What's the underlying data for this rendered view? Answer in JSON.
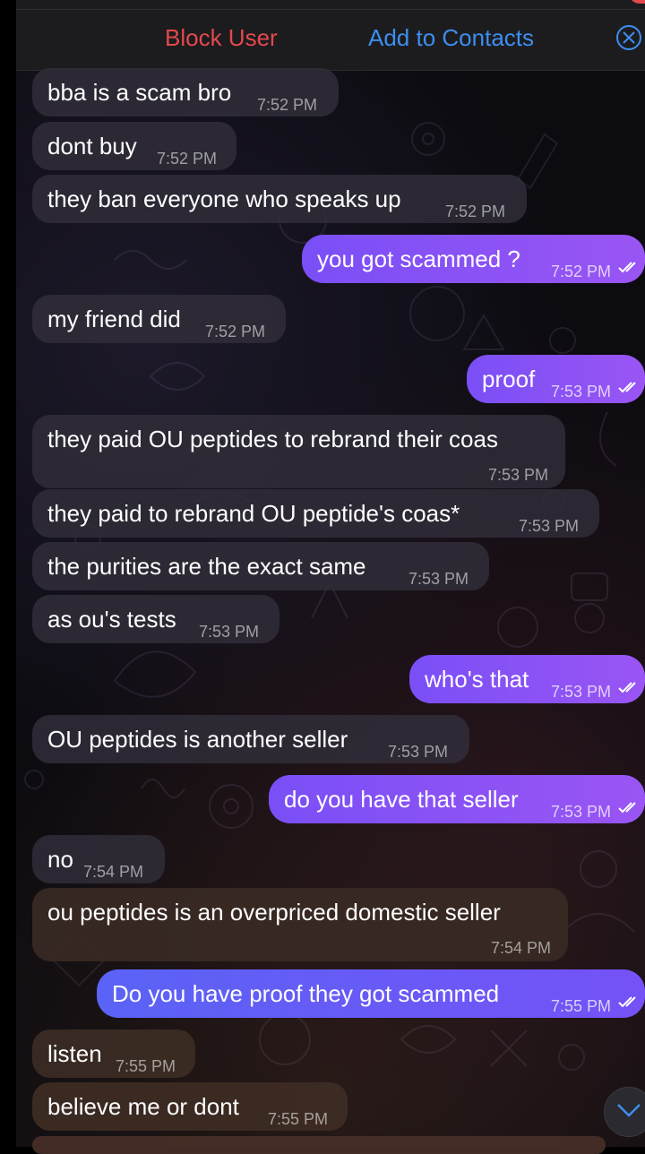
{
  "header": {
    "block_user": "Block User",
    "add_to_contacts": "Add to Contacts",
    "close_icon": "close-icon"
  },
  "colors": {
    "block_red": "#e5484d",
    "link_blue": "#3d8ef0",
    "outgoing_purple": "#8a52f5",
    "outgoing_blue": "#5a63f5",
    "incoming_gray": "#302c38"
  },
  "messages": [
    {
      "dir": "in",
      "text": "bba is a scam bro",
      "time": "7:52 PM"
    },
    {
      "dir": "in",
      "text": "dont buy",
      "time": "7:52 PM"
    },
    {
      "dir": "in",
      "text": "they ban everyone who speaks up",
      "time": "7:52 PM"
    },
    {
      "dir": "out",
      "text": "you got scammed ?",
      "time": "7:52 PM",
      "read": true
    },
    {
      "dir": "in",
      "text": "my friend did",
      "time": "7:52 PM"
    },
    {
      "dir": "out",
      "text": "proof",
      "time": "7:53 PM",
      "read": true
    },
    {
      "dir": "in",
      "text": "they paid OU peptides to rebrand their coas",
      "time": "7:53 PM"
    },
    {
      "dir": "in",
      "text": "they paid to rebrand OU peptide's coas*",
      "time": "7:53 PM"
    },
    {
      "dir": "in",
      "text": "the purities are the exact same",
      "time": "7:53 PM"
    },
    {
      "dir": "in",
      "text": "as ou's tests",
      "time": "7:53 PM"
    },
    {
      "dir": "out",
      "text": "who's that",
      "time": "7:53 PM",
      "read": true
    },
    {
      "dir": "in",
      "text": "OU peptides is another seller",
      "time": "7:53 PM"
    },
    {
      "dir": "out",
      "text": "do you have that seller",
      "time": "7:53 PM",
      "read": true
    },
    {
      "dir": "in",
      "text": "no",
      "time": "7:54 PM"
    },
    {
      "dir": "in",
      "text": "ou peptides is an overpriced domestic seller",
      "time": "7:54 PM"
    },
    {
      "dir": "out",
      "text": "Do you have proof they got scammed",
      "time": "7:55 PM",
      "read": true
    },
    {
      "dir": "in",
      "text": "listen",
      "time": "7:55 PM"
    },
    {
      "dir": "in",
      "text": "believe me or dont",
      "time": "7:55 PM"
    }
  ],
  "icons": {
    "read_receipt": "double-check-icon",
    "scroll_down": "chevron-down-icon"
  }
}
